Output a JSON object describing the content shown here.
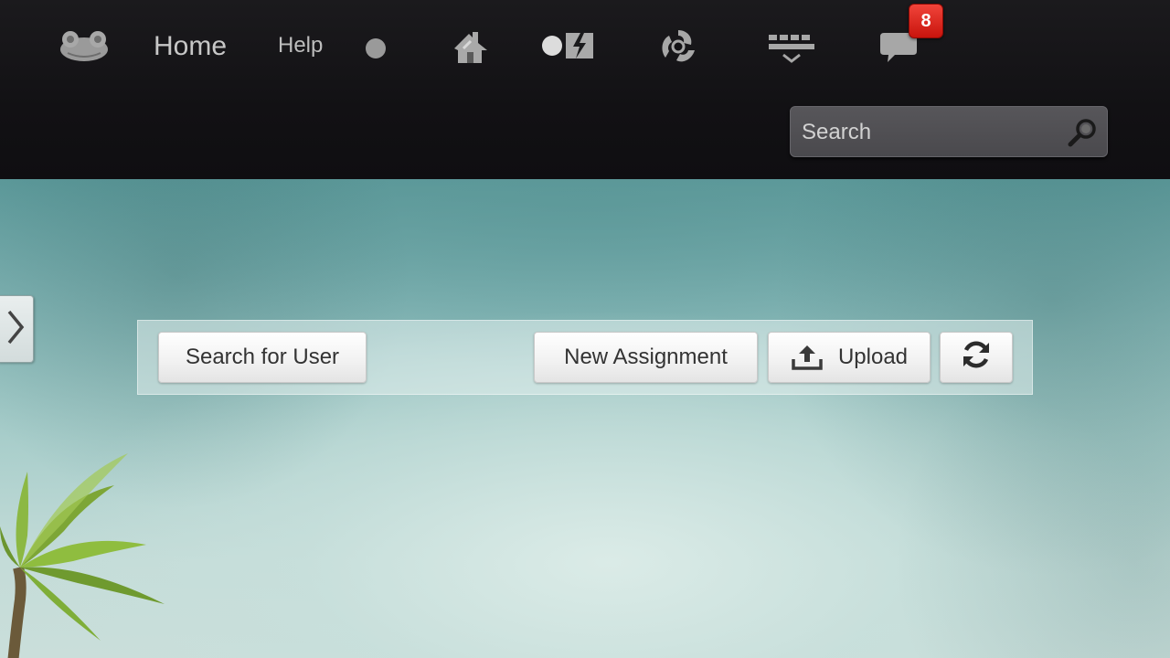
{
  "header": {
    "nav": {
      "home_label": "Home",
      "help_label": "Help"
    },
    "icons": [
      "frog-logo-icon",
      "dot-icon",
      "house-icon",
      "apps-icon",
      "spinner-icon",
      "keyboard-icon",
      "chat-icon"
    ],
    "notifications": {
      "count": "8",
      "badge_color": "#d9221a"
    },
    "search": {
      "placeholder": "Search"
    }
  },
  "toolbar": {
    "search_user_label": "Search for User",
    "new_assignment_label": "New Assignment",
    "upload_label": "Upload",
    "refresh_icon": "refresh-icon"
  },
  "sidebar": {
    "toggle_icon": "chevron-right-icon"
  },
  "colors": {
    "header_bg": "#141316",
    "background_teal": "#7fb2b2",
    "button_bg": "#f4f4f4"
  }
}
